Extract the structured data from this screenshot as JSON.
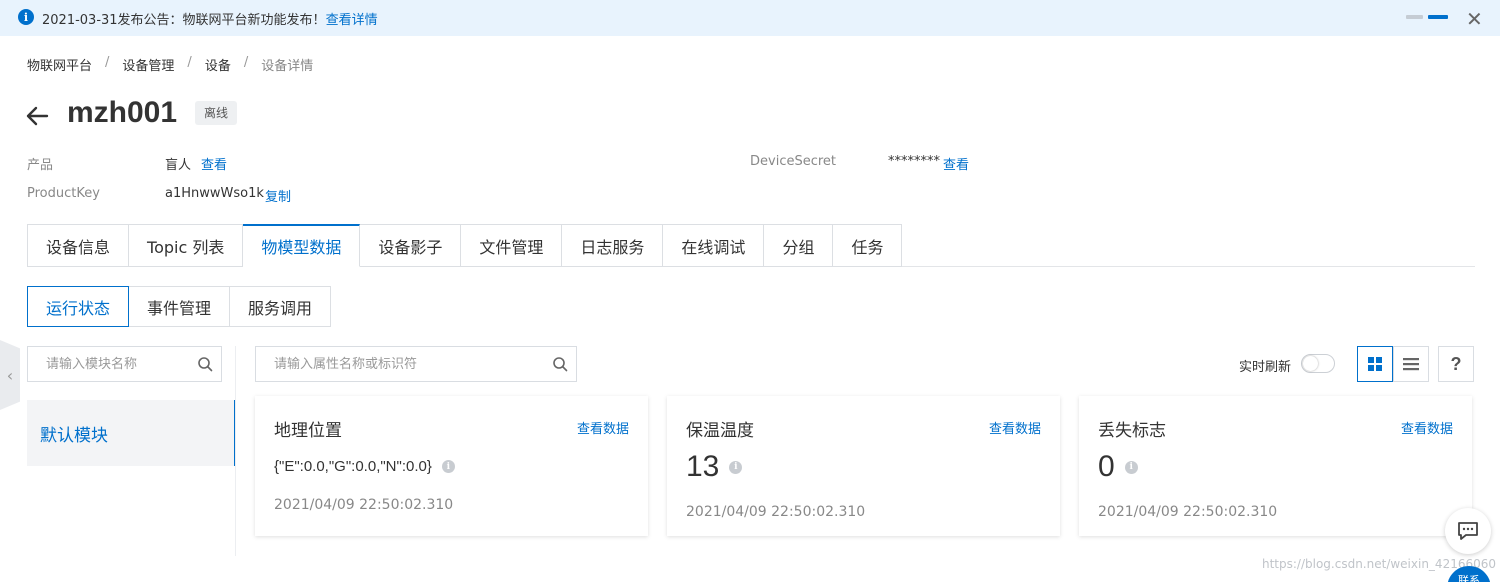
{
  "announcement": {
    "text": "2021-03-31发布公告：物联网平台新功能发布！",
    "link": "查看详情"
  },
  "breadcrumb": [
    "物联网平台",
    "设备管理",
    "设备",
    "设备详情"
  ],
  "device": {
    "name": "mzh001",
    "status": "离线"
  },
  "meta": {
    "product_label": "产品",
    "product_value": "盲人",
    "product_link": "查看",
    "productkey_label": "ProductKey",
    "productkey_value": "a1HnwwWso1k",
    "productkey_link": "复制",
    "secret_label": "DeviceSecret",
    "secret_value": "********",
    "secret_link": "查看"
  },
  "tabs": [
    "设备信息",
    "Topic 列表",
    "物模型数据",
    "设备影子",
    "文件管理",
    "日志服务",
    "在线调试",
    "分组",
    "任务"
  ],
  "subtabs": [
    "运行状态",
    "事件管理",
    "服务调用"
  ],
  "module_search": {
    "placeholder": "请输入模块名称"
  },
  "modules": [
    "默认模块"
  ],
  "property_search": {
    "placeholder": "请输入属性名称或标识符"
  },
  "toolbar": {
    "realtime_label": "实时刷新",
    "help": "?"
  },
  "cards": [
    {
      "title": "地理位置",
      "link": "查看数据",
      "value": "{\"E\":0.0,\"G\":0.0,\"N\":0.0}",
      "time": "2021/04/09 22:50:02.310"
    },
    {
      "title": "保温温度",
      "link": "查看数据",
      "value": "13",
      "time": "2021/04/09 22:50:02.310"
    },
    {
      "title": "丢失标志",
      "link": "查看数据",
      "value": "0",
      "time": "2021/04/09 22:50:02.310"
    }
  ],
  "float_button_text": "联系",
  "watermark": "https://blog.csdn.net/weixin_42166060",
  "colors": {
    "accent": "#0070cc",
    "banner": "#e8f3fd"
  }
}
